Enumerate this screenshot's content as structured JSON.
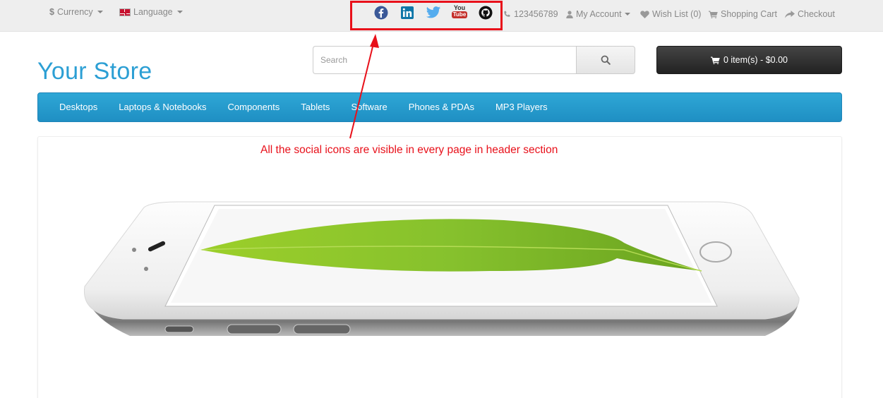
{
  "topbar": {
    "currency_label": "Currency",
    "language_label": "Language",
    "phone": "123456789",
    "my_account": "My Account",
    "wish_list": "Wish List (0)",
    "shopping_cart": "Shopping Cart",
    "checkout": "Checkout",
    "social_icons": [
      "facebook-icon",
      "linkedin-icon",
      "twitter-icon",
      "youtube-icon",
      "github-icon"
    ],
    "youtube_text_top": "You",
    "youtube_text_bottom": "Tube"
  },
  "header": {
    "logo": "Your Store",
    "search_placeholder": "Search",
    "cart_label": "0 item(s) - $0.00"
  },
  "menu": {
    "items": [
      "Desktops",
      "Laptops & Notebooks",
      "Components",
      "Tablets",
      "Software",
      "Phones & PDAs",
      "MP3 Players"
    ]
  },
  "annotation": {
    "text": "All the social icons are visible in every page in header section",
    "color": "#e8101a"
  },
  "colors": {
    "accent": "#2c9fd4",
    "menu_bg": "#229ac8",
    "cart_bg": "#333333",
    "facebook": "#3b5998",
    "linkedin": "#0e76a8",
    "twitter": "#55acee",
    "youtube": "#c4302b"
  }
}
